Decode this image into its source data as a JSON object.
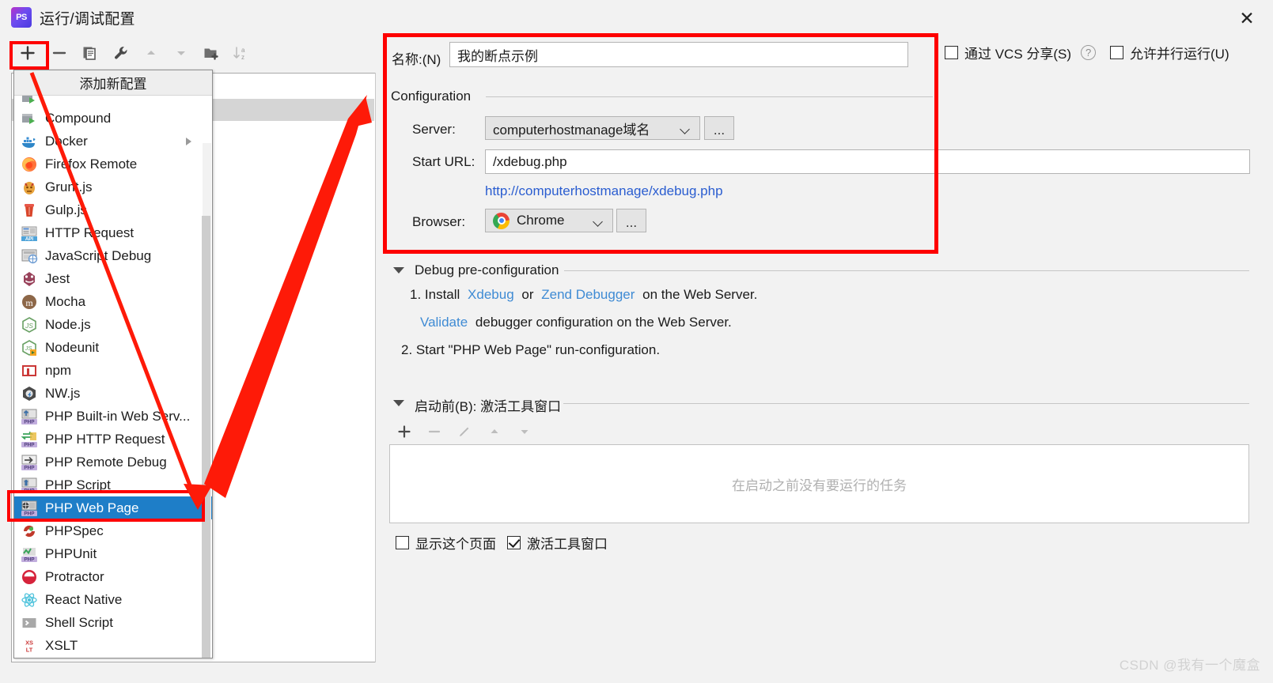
{
  "window": {
    "title": "运行/调试配置",
    "app_icon": "phpstorm-icon",
    "close_label": "✕"
  },
  "toolbar": {
    "buttons": [
      {
        "name": "add-configuration-button",
        "icon": "plus-icon",
        "tooltip": "+"
      },
      {
        "name": "remove-configuration-button",
        "icon": "minus-icon",
        "tooltip": "−"
      },
      {
        "name": "copy-configuration-button",
        "icon": "copy-icon",
        "tooltip": "Copy"
      },
      {
        "name": "edit-templates-button",
        "icon": "wrench-icon",
        "tooltip": "Edit templates"
      },
      {
        "name": "move-up-button",
        "icon": "triangle-up-icon",
        "tooltip": "Move up"
      },
      {
        "name": "move-down-button",
        "icon": "triangle-down-icon",
        "tooltip": "Move down"
      },
      {
        "name": "new-folder-button",
        "icon": "folder-add-icon",
        "tooltip": "New folder"
      },
      {
        "name": "sort-button",
        "icon": "sort-az-icon",
        "tooltip": "Sort"
      }
    ]
  },
  "popup": {
    "header": "添加新配置",
    "items": [
      {
        "label": "Compound",
        "icon": "compound-icon",
        "selected": false,
        "submenu": false
      },
      {
        "label": "Docker",
        "icon": "docker-icon",
        "selected": false,
        "submenu": true
      },
      {
        "label": "Firefox Remote",
        "icon": "firefox-icon",
        "selected": false,
        "submenu": false
      },
      {
        "label": "Grunt.js",
        "icon": "grunt-icon",
        "selected": false,
        "submenu": false
      },
      {
        "label": "Gulp.js",
        "icon": "gulp-icon",
        "selected": false,
        "submenu": false
      },
      {
        "label": "HTTP Request",
        "icon": "http-request-icon",
        "selected": false,
        "submenu": false
      },
      {
        "label": "JavaScript Debug",
        "icon": "javascript-debug-icon",
        "selected": false,
        "submenu": false
      },
      {
        "label": "Jest",
        "icon": "jest-icon",
        "selected": false,
        "submenu": false
      },
      {
        "label": "Mocha",
        "icon": "mocha-icon",
        "selected": false,
        "submenu": false
      },
      {
        "label": "Node.js",
        "icon": "nodejs-icon",
        "selected": false,
        "submenu": false
      },
      {
        "label": "Nodeunit",
        "icon": "nodeunit-icon",
        "selected": false,
        "submenu": false
      },
      {
        "label": "npm",
        "icon": "npm-icon",
        "selected": false,
        "submenu": false
      },
      {
        "label": "NW.js",
        "icon": "nwjs-icon",
        "selected": false,
        "submenu": false
      },
      {
        "label": "PHP Built-in Web Serv...",
        "icon": "php-builtin-server-icon",
        "selected": false,
        "submenu": false
      },
      {
        "label": "PHP HTTP Request",
        "icon": "php-http-request-icon",
        "selected": false,
        "submenu": false
      },
      {
        "label": "PHP Remote Debug",
        "icon": "php-remote-debug-icon",
        "selected": false,
        "submenu": false
      },
      {
        "label": "PHP Script",
        "icon": "php-script-icon",
        "selected": false,
        "submenu": false
      },
      {
        "label": "PHP Web Page",
        "icon": "php-web-page-icon",
        "selected": true,
        "submenu": false
      },
      {
        "label": "PHPSpec",
        "icon": "phpspec-icon",
        "selected": false,
        "submenu": false
      },
      {
        "label": "PHPUnit",
        "icon": "phpunit-icon",
        "selected": false,
        "submenu": false
      },
      {
        "label": "Protractor",
        "icon": "protractor-icon",
        "selected": false,
        "submenu": false
      },
      {
        "label": "React Native",
        "icon": "react-native-icon",
        "selected": false,
        "submenu": false
      },
      {
        "label": "Shell Script",
        "icon": "shell-script-icon",
        "selected": false,
        "submenu": false
      },
      {
        "label": "XSLT",
        "icon": "xslt-icon",
        "selected": false,
        "submenu": false
      }
    ]
  },
  "form": {
    "name_label": "名称:(N)",
    "name_value": "我的断点示例",
    "share_vcs_label": "通过 VCS 分享(S)",
    "share_vcs_checked": false,
    "help_icon": "question-mark-icon",
    "allow_parallel_label": "允许并行运行(U)",
    "allow_parallel_checked": false,
    "configuration_group": "Configuration",
    "server_label": "Server:",
    "server_value": "computerhostmanage域名",
    "server_browse": "...",
    "start_url_label": "Start URL:",
    "start_url_value": "/xdebug.php",
    "url_preview": "http://computerhostmanage/xdebug.php",
    "browser_label": "Browser:",
    "browser_value": "Chrome",
    "browser_browse": "..."
  },
  "debug_pre": {
    "title": "Debug pre-configuration",
    "step1_prefix": "1. Install",
    "step1_link1": "Xdebug",
    "step1_mid": "or",
    "step1_link2": "Zend Debugger",
    "step1_suffix": "on the Web Server.",
    "step2_link": "Validate",
    "step2_suffix": "debugger configuration on the Web Server.",
    "step3": "2. Start \"PHP Web Page\" run-configuration."
  },
  "before_launch": {
    "title": "启动前(B): 激活工具窗口",
    "toolbar": [
      {
        "name": "add-task-button",
        "icon": "plus-icon",
        "enabled": true
      },
      {
        "name": "remove-task-button",
        "icon": "minus-icon",
        "enabled": false
      },
      {
        "name": "edit-task-button",
        "icon": "pencil-icon",
        "enabled": false
      },
      {
        "name": "move-task-up-button",
        "icon": "triangle-up-icon",
        "enabled": false
      },
      {
        "name": "move-task-down-button",
        "icon": "triangle-down-icon",
        "enabled": false
      }
    ],
    "empty_text": "在启动之前没有要运行的任务",
    "show_page_label": "显示这个页面",
    "show_page_checked": false,
    "activate_tool_window_label": "激活工具窗口",
    "activate_tool_window_checked": true
  },
  "annotations": {
    "highlight_color": "#fe0000",
    "arrow": "red-arrow-pointing-to-configuration-panel"
  },
  "watermark": "CSDN @我有一个魔盒"
}
